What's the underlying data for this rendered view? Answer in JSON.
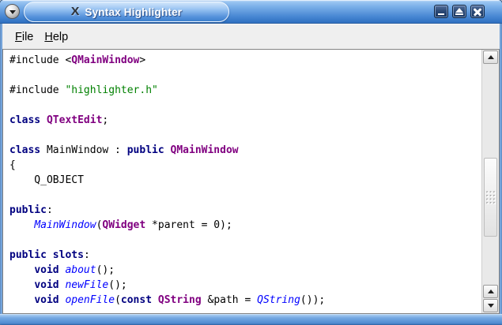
{
  "window": {
    "title": "Syntax Highlighter"
  },
  "icons": {
    "app_glyph": "X",
    "app": "x11-logo",
    "window_menu": "chevron-down",
    "minimize": "underscore-bar",
    "maximize": "eject-triangle-over-bar",
    "close": "x-cross",
    "scroll_up": "triangle-up",
    "scroll_down": "triangle-down"
  },
  "menubar": {
    "items": [
      {
        "label": "File"
      },
      {
        "label": "Help"
      }
    ]
  },
  "editor": {
    "lines": [
      [
        [
          "plain",
          "#include <"
        ],
        [
          "qtclass",
          "QMainWindow"
        ],
        [
          "plain",
          ">"
        ]
      ],
      [],
      [
        [
          "plain",
          "#include "
        ],
        [
          "string",
          "\"highlighter.h\""
        ]
      ],
      [],
      [
        [
          "keyword",
          "class"
        ],
        [
          "plain",
          " "
        ],
        [
          "qtclass",
          "QTextEdit"
        ],
        [
          "plain",
          ";"
        ]
      ],
      [],
      [
        [
          "keyword",
          "class"
        ],
        [
          "plain",
          " MainWindow : "
        ],
        [
          "keyword",
          "public"
        ],
        [
          "plain",
          " "
        ],
        [
          "qtclass",
          "QMainWindow"
        ]
      ],
      [
        [
          "plain",
          "{"
        ]
      ],
      [
        [
          "plain",
          "    Q_OBJECT"
        ]
      ],
      [],
      [
        [
          "keyword",
          "public"
        ],
        [
          "plain",
          ":"
        ]
      ],
      [
        [
          "plain",
          "    "
        ],
        [
          "function",
          "MainWindow"
        ],
        [
          "plain",
          "("
        ],
        [
          "qtclass",
          "QWidget"
        ],
        [
          "plain",
          " *parent = 0);"
        ]
      ],
      [],
      [
        [
          "keyword",
          "public"
        ],
        [
          "plain",
          " "
        ],
        [
          "keyword",
          "slots"
        ],
        [
          "plain",
          ":"
        ]
      ],
      [
        [
          "plain",
          "    "
        ],
        [
          "keyword",
          "void"
        ],
        [
          "plain",
          " "
        ],
        [
          "function",
          "about"
        ],
        [
          "plain",
          "();"
        ]
      ],
      [
        [
          "plain",
          "    "
        ],
        [
          "keyword",
          "void"
        ],
        [
          "plain",
          " "
        ],
        [
          "function",
          "newFile"
        ],
        [
          "plain",
          "();"
        ]
      ],
      [
        [
          "plain",
          "    "
        ],
        [
          "keyword",
          "void"
        ],
        [
          "plain",
          " "
        ],
        [
          "function",
          "openFile"
        ],
        [
          "plain",
          "("
        ],
        [
          "keyword",
          "const"
        ],
        [
          "plain",
          " "
        ],
        [
          "qtclass",
          "QString"
        ],
        [
          "plain",
          " &path = "
        ],
        [
          "function",
          "QString"
        ],
        [
          "plain",
          "());"
        ]
      ]
    ]
  },
  "colors": {
    "keyword": "#000080",
    "qtclass": "#800080",
    "string": "#008000",
    "function": "#0000ff",
    "plain": "#000000",
    "titlebar_accent": "#3f80cd",
    "window_border": "#5d92cd",
    "menubar_bg": "#efefef",
    "editor_bg": "#ffffff"
  }
}
